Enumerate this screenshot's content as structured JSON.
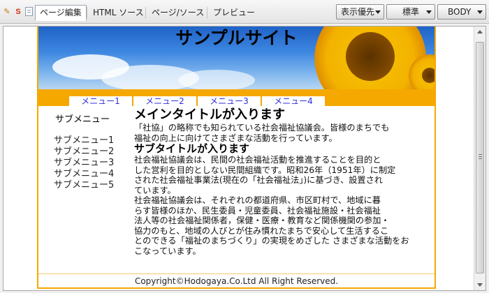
{
  "toolbar": {
    "tabs": [
      "ページ編集",
      "HTML ソース",
      "ページ/ソース",
      "プレビュー"
    ],
    "dropdowns": [
      "表示優先",
      "標準",
      "BODY"
    ],
    "icons": [
      "pencil-icon",
      "s-icon",
      "document-icon"
    ]
  },
  "site": {
    "title": "サンプルサイト",
    "menu": [
      "メニュー1",
      "メニュー2",
      "メニュー3",
      "メニュー4"
    ],
    "side_title": "サブメニュー",
    "side_items": [
      "サブメニュー1",
      "サブメニュー2",
      "サブメニュー3",
      "サブメニュー4",
      "サブメニュー5"
    ],
    "main_title": "メインタイトルが入ります",
    "para1": [
      "「社協」の略称でも知られている社会福祉協議会。皆様のまちでも",
      "福祉の向上に向けてさまざまな活動を行っています。"
    ],
    "sub_title": "サブタイトルが入ります",
    "para2": [
      "社会福祉協議会は、民間の社会福祉活動を推進することを目的と",
      "した営利を目的としない民間組織です。昭和26年（1951年）に制定",
      "された社会福祉事業法(現在の「社会福祉法」)に基づき、設置され",
      "ています。"
    ],
    "para3": [
      "社会福祉協議会は、それぞれの都道府県、市区町村で、地域に暮",
      "らす皆様のほか、民生委員・児童委員、社会福祉施設・社会福祉",
      "法人等の社会福祉関係者，保健・医療・教育など関係機関の参加・",
      "協力のもと、地域の人びとが住み慣れたまちで安心して生活するこ",
      "とのできる「福祉のまちづくり」の実現をめざした さまざまな活動をお",
      "こなっています。"
    ],
    "footer": "Copyright©Hodogaya.Co.Ltd All Right Reserved."
  },
  "colors": {
    "accent": "#f5a800",
    "menu_text": "#2e2edc"
  }
}
